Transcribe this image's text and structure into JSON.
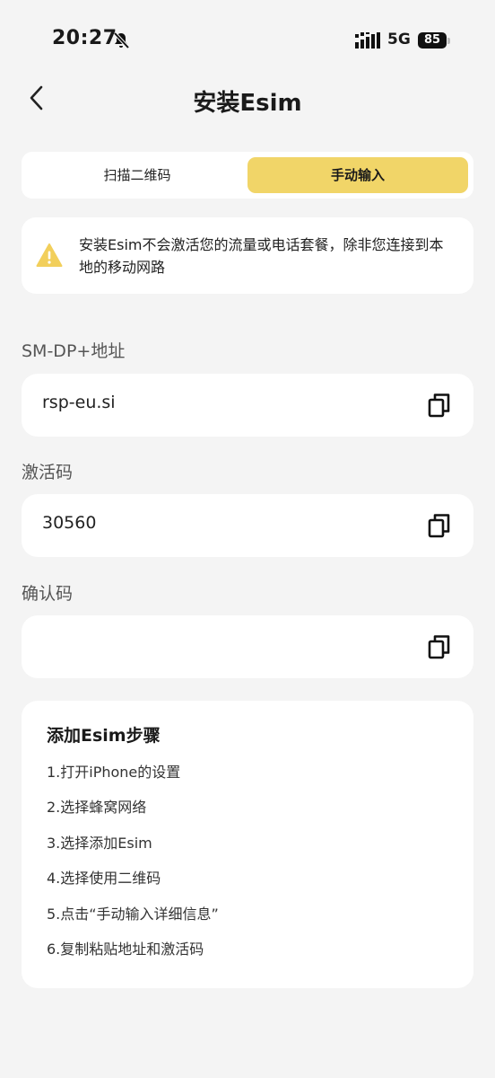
{
  "status": {
    "time": "20:27",
    "network": "5G",
    "battery": "85"
  },
  "header": {
    "title": "安装Esim"
  },
  "tabs": {
    "scan": "扫描二维码",
    "manual": "手动输入"
  },
  "notice": {
    "text": "安装Esim不会激活您的流量或电话套餐，除非您连接到本地的移动网路"
  },
  "fields": {
    "smdp": {
      "label": "SM-DP+地址",
      "value": "rsp-eu.si"
    },
    "activation": {
      "label": "激活码",
      "value": "30560"
    },
    "confirm": {
      "label": "确认码",
      "value": ""
    }
  },
  "steps": {
    "title": "添加Esim步骤",
    "items": [
      "1.打开iPhone的设置",
      "2.选择蜂窝网络",
      "3.选择添加Esim",
      "4.选择使用二维码",
      "5.点击“手动输入详细信息”",
      "6.复制粘贴地址和激活码"
    ]
  },
  "colors": {
    "accent": "#f1d568",
    "background": "#f4f4f4",
    "warning": "#f2cf5b"
  },
  "icons": {
    "back": "chevron-left-icon",
    "warning": "warning-icon",
    "copy": "copy-icon",
    "bell": "bell-slash-icon"
  }
}
